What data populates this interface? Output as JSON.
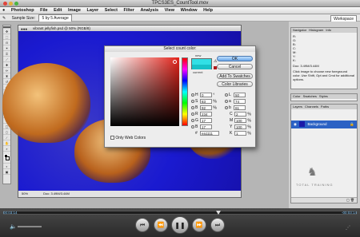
{
  "window": {
    "title": "TPCS3ES_CountTool.mov",
    "traffic_lights": [
      "#e0443b",
      "#e3b13a",
      "#4bb443"
    ]
  },
  "menubar": {
    "apple": "",
    "items": [
      "Photoshop",
      "File",
      "Edit",
      "Image",
      "Layer",
      "Select",
      "Filter",
      "Analysis",
      "View",
      "Window",
      "Help"
    ],
    "right": "Workspace"
  },
  "options": {
    "label": "Sample Size:",
    "value": "5 by 5 Average"
  },
  "document": {
    "title": "vibrant jellyfish.psd @ 50% (RGB/8)",
    "zoom": "50%",
    "doc_info": "Doc: 3.49M/3.44M"
  },
  "dialog": {
    "title": "Select count color:",
    "new_label": "new",
    "current_label": "current",
    "new_color": "#31e0e6",
    "current_color": "#17c2c8",
    "buttons": {
      "ok": "OK",
      "cancel": "Cancel",
      "add": "Add To Swatches",
      "libraries": "Color Libraries"
    },
    "only_web": "Only Web Colors",
    "fields_left": [
      {
        "k": "H",
        "v": "0",
        "u": "°"
      },
      {
        "k": "S",
        "v": "83",
        "u": "%"
      },
      {
        "k": "B",
        "v": "92",
        "u": "%"
      },
      {
        "k": "R",
        "v": "234",
        "u": ""
      },
      {
        "k": "G",
        "v": "17",
        "u": ""
      },
      {
        "k": "B",
        "v": "17",
        "u": ""
      }
    ],
    "fields_right": [
      {
        "k": "L",
        "v": "50",
        "u": ""
      },
      {
        "k": "a",
        "v": "74",
        "u": ""
      },
      {
        "k": "b",
        "v": "61",
        "u": ""
      },
      {
        "k": "C",
        "v": "2",
        "u": "%"
      },
      {
        "k": "M",
        "v": "100",
        "u": "%"
      },
      {
        "k": "Y",
        "v": "100",
        "u": "%"
      },
      {
        "k": "K",
        "v": "1",
        "u": "%"
      }
    ],
    "hex_label": "#",
    "hex": "ea1111"
  },
  "panels": {
    "nav_tabs": [
      "Navigator",
      "Histogram",
      "Info"
    ],
    "info_rows": [
      "R:",
      "G:",
      "B:",
      "C:",
      "M:",
      "Y:",
      "K:"
    ],
    "info_hint": "Click image to choose new foreground color. Use Shift, Opt and Cmd for additional options.",
    "info_doc": "Doc: 3.49M/3.44M",
    "mid_tabs": [
      "Color",
      "Swatches",
      "Styles"
    ],
    "layer_tabs": [
      "Layers",
      "Channels",
      "Paths"
    ],
    "layer_name": "Background"
  },
  "watermark": "TOTAL TRAINING",
  "player": {
    "time_left": "00:03:14",
    "time_right": "-00:03:14"
  }
}
